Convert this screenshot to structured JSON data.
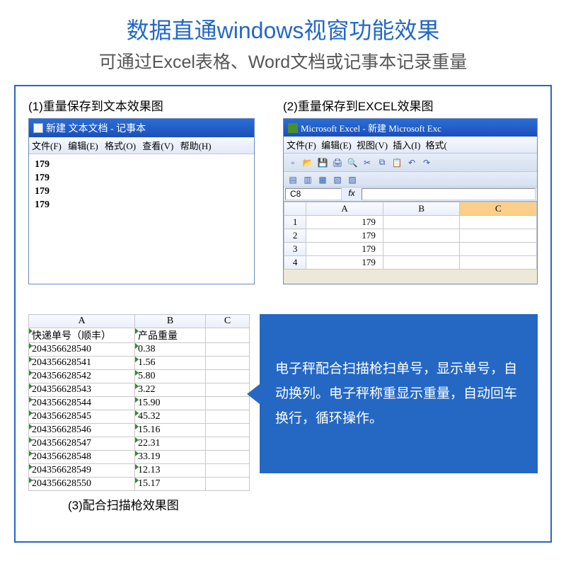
{
  "page": {
    "title": "数据直通windows视窗功能效果",
    "subtitle": "可通过Excel表格、Word文档或记事本记录重量"
  },
  "notepad_demo": {
    "caption": "(1)重量保存到文本效果图",
    "title": "新建 文本文档 - 记事本",
    "menus": {
      "file": "文件(F)",
      "edit": "编辑(E)",
      "format": "格式(O)",
      "view": "查看(V)",
      "help": "帮助(H)"
    },
    "lines": [
      "179",
      "179",
      "179",
      "179"
    ]
  },
  "excel_demo": {
    "caption": "(2)重量保存到EXCEL效果图",
    "title": "Microsoft Excel - 新建 Microsoft Exc",
    "menus": {
      "file": "文件(F)",
      "edit": "编辑(E)",
      "view": "视图(V)",
      "insert": "插入(I)",
      "format": "格式("
    },
    "namebox": "C8",
    "fx": "fx",
    "cols": [
      "A",
      "B",
      "C"
    ],
    "rows": [
      {
        "n": "1",
        "a": "179",
        "b": "",
        "c": ""
      },
      {
        "n": "2",
        "a": "179",
        "b": "",
        "c": ""
      },
      {
        "n": "3",
        "a": "179",
        "b": "",
        "c": ""
      },
      {
        "n": "4",
        "a": "179",
        "b": "",
        "c": ""
      }
    ]
  },
  "scanner_demo": {
    "caption": "(3)配合扫描枪效果图",
    "cols": [
      "A",
      "B",
      "C"
    ],
    "header": {
      "a": "快递单号（顺丰）",
      "b": "产品重量",
      "c": ""
    },
    "rows": [
      {
        "a": "204356628540",
        "b": "0.38"
      },
      {
        "a": "204356628541",
        "b": "1.56"
      },
      {
        "a": "204356628542",
        "b": "5.80"
      },
      {
        "a": "204356628543",
        "b": "3.22"
      },
      {
        "a": "204356628544",
        "b": "15.90"
      },
      {
        "a": "204356628545",
        "b": "45.32"
      },
      {
        "a": "204356628546",
        "b": "15.16"
      },
      {
        "a": "204356628547",
        "b": "22.31"
      },
      {
        "a": "204356628548",
        "b": "33.19"
      },
      {
        "a": "204356628549",
        "b": "12.13"
      },
      {
        "a": "204356628550",
        "b": "15.17"
      }
    ]
  },
  "blue_box": {
    "text": "电子秤配合扫描枪扫单号，显示单号，自动换列。电子秤称重显示重量，自动回车换行，循环操作。"
  }
}
